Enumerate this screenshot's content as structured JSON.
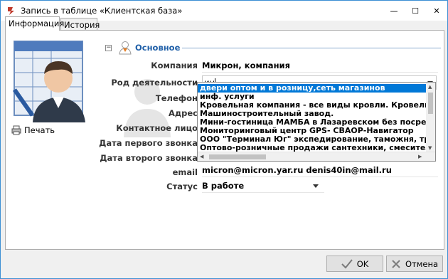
{
  "window": {
    "title": "Запись в таблице «Клиентская база»",
    "controls": {
      "minimize": "—",
      "maximize": "☐",
      "close": "✕"
    }
  },
  "tabs": [
    {
      "label": "Информация",
      "active": true
    },
    {
      "label": "История",
      "active": false
    }
  ],
  "left": {
    "print_label": "Печать",
    "avatar_icon": "user-card-icon"
  },
  "section": {
    "collapse": "⊟",
    "title": "Основное"
  },
  "fields": {
    "company": {
      "label": "Компания",
      "value": "Микрон, компания"
    },
    "activity": {
      "label": "Род деятельности",
      "value": "ин"
    },
    "phone": {
      "label": "Телефон"
    },
    "address": {
      "label": "Адрес"
    },
    "contact": {
      "label": "Контактное лицо"
    },
    "first_call": {
      "label": "Дата первого звонка"
    },
    "second_call": {
      "label": "Дата второго звонка"
    },
    "email": {
      "label": "email",
      "value": "micron@micron.yar.ru denis40in@mail.ru"
    },
    "status": {
      "label": "Статус",
      "value": "В работе"
    }
  },
  "dropdown": {
    "items": [
      "двери оптом и в розницу,сеть магазинов",
      "инф. услуги",
      "Кровельная компания - все виды кровли. Кровельные работы",
      "Машиностроительный завод.",
      "Мини-гостиница МАМБА в Лазаревском без посредников",
      "Мониторинговый центр GPS- СВАОР-Навигатор",
      "ООО \"Терминал Юг\" экспедирование, таможня, транспорт",
      "Оптово-розничные продажи сантехники, смесителей, с"
    ],
    "selected_index": 0
  },
  "buttons": {
    "ok": "OK",
    "cancel": "Отмена"
  },
  "colors": {
    "accent": "#0078d7",
    "section_title": "#1f5fa8",
    "window_border": "#3c8fd4"
  }
}
